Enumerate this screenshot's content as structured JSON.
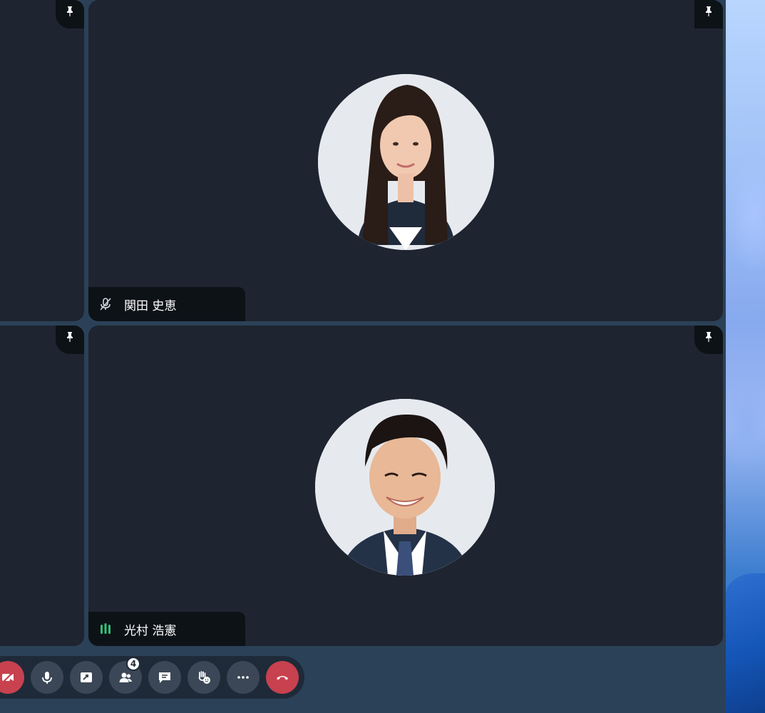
{
  "participants": [
    {
      "name": "関田 史恵",
      "status": "muted",
      "status_icon": "mic-off-icon",
      "pin_icon": "pin-icon",
      "avatar_desc": "woman-avatar"
    },
    {
      "name": "光村 浩憲",
      "status": "speaking",
      "status_icon": "speaking-bars-icon",
      "pin_icon": "pin-icon",
      "avatar_desc": "man-avatar"
    }
  ],
  "toolbar": {
    "participants_count": "4",
    "buttons": [
      {
        "id": "camera",
        "icon": "camera-off-icon",
        "color": "#c8414f"
      },
      {
        "id": "mic",
        "icon": "microphone-icon",
        "color": "#3b4756"
      },
      {
        "id": "share",
        "icon": "share-screen-icon",
        "color": "#3b4756"
      },
      {
        "id": "participants",
        "icon": "participants-icon",
        "color": "#3b4756"
      },
      {
        "id": "chat",
        "icon": "chat-icon",
        "color": "#3b4756"
      },
      {
        "id": "reactions",
        "icon": "raise-hand-icon",
        "color": "#3b4756"
      },
      {
        "id": "more",
        "icon": "more-icon",
        "color": "#3b4756"
      },
      {
        "id": "leave",
        "icon": "hang-up-icon",
        "color": "#c8414f"
      }
    ]
  },
  "colors": {
    "tile_bg": "#1e2430",
    "app_bg": "#2b4157",
    "nameplate_bg": "#0d1217",
    "danger": "#c8414f",
    "speaking": "#2fc27a"
  }
}
